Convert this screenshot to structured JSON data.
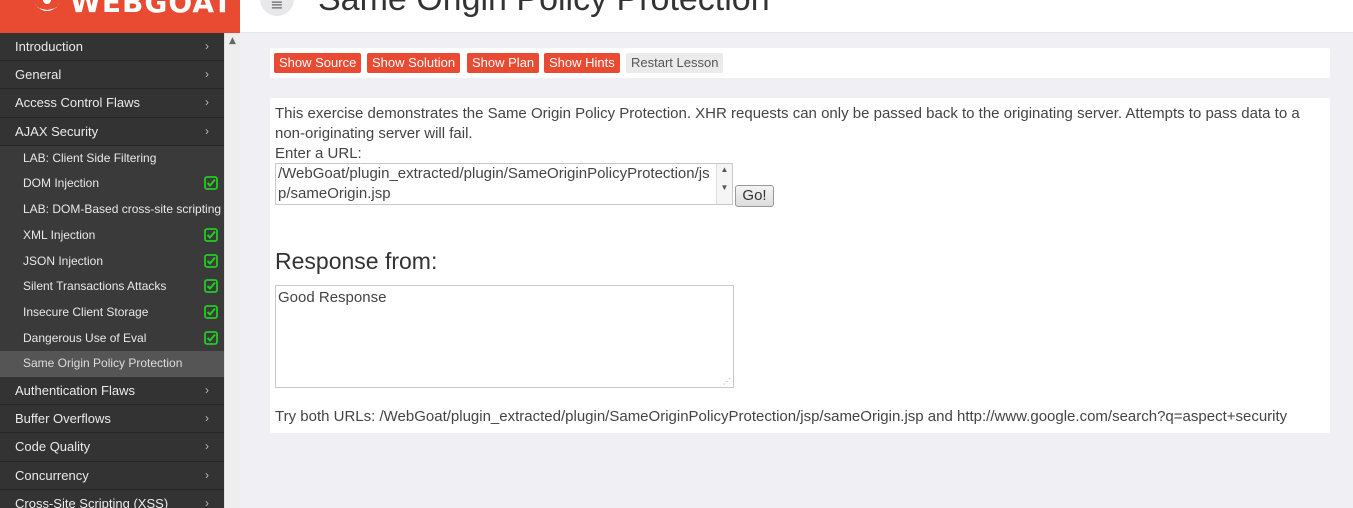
{
  "app": {
    "logo_text": "WEBGOAT",
    "title": "Same Origin Policy Protection"
  },
  "header": {
    "menu_toggle": "≡"
  },
  "sidebar": {
    "items_before": [
      {
        "label": "Introduction",
        "chevron": "›"
      },
      {
        "label": "General",
        "chevron": "›"
      },
      {
        "label": "Access Control Flaws",
        "chevron": "›"
      },
      {
        "label": "AJAX Security",
        "chevron": "›"
      }
    ],
    "subitems": [
      {
        "label": "LAB: Client Side Filtering",
        "completed": false
      },
      {
        "label": "DOM Injection",
        "completed": true
      },
      {
        "label": "LAB: DOM-Based cross-site scripting",
        "completed": false
      },
      {
        "label": "XML Injection",
        "completed": true
      },
      {
        "label": "JSON Injection",
        "completed": true
      },
      {
        "label": "Silent Transactions Attacks",
        "completed": true
      },
      {
        "label": "Insecure Client Storage",
        "completed": true
      },
      {
        "label": "Dangerous Use of Eval",
        "completed": true
      },
      {
        "label": "Same Origin Policy Protection",
        "completed": false,
        "active": true
      }
    ],
    "items_after": [
      {
        "label": "Authentication Flaws",
        "chevron": "›"
      },
      {
        "label": "Buffer Overflows",
        "chevron": "›"
      },
      {
        "label": "Code Quality",
        "chevron": "›"
      },
      {
        "label": "Concurrency",
        "chevron": "›"
      },
      {
        "label": "Cross-Site Scripting (XSS)",
        "chevron": "›"
      }
    ]
  },
  "toolbar": {
    "show_source": "Show Source",
    "show_solution": "Show Solution",
    "show_plan": "Show Plan",
    "show_hints": "Show Hints",
    "restart": "Restart Lesson"
  },
  "lesson": {
    "description": "This exercise demonstrates the Same Origin Policy Protection. XHR requests can only be passed back to the originating server. Attempts to pass data to a non-originating server will fail.",
    "url_label": "Enter a URL:",
    "url_value": "/WebGoat/plugin_extracted/plugin/SameOriginPolicyProtection/jsp/sameOrigin.jsp",
    "go_label": "Go!",
    "response_heading": "Response from:",
    "response_value": "Good Response",
    "hint_text": "Try both URLs: /WebGoat/plugin_extracted/plugin/SameOriginPolicyProtection/jsp/sameOrigin.jsp and http://www.google.com/search?q=aspect+security"
  },
  "colors": {
    "accent": "#e84a32",
    "sidebar_bg": "#333333",
    "check_green": "#22cc22"
  }
}
